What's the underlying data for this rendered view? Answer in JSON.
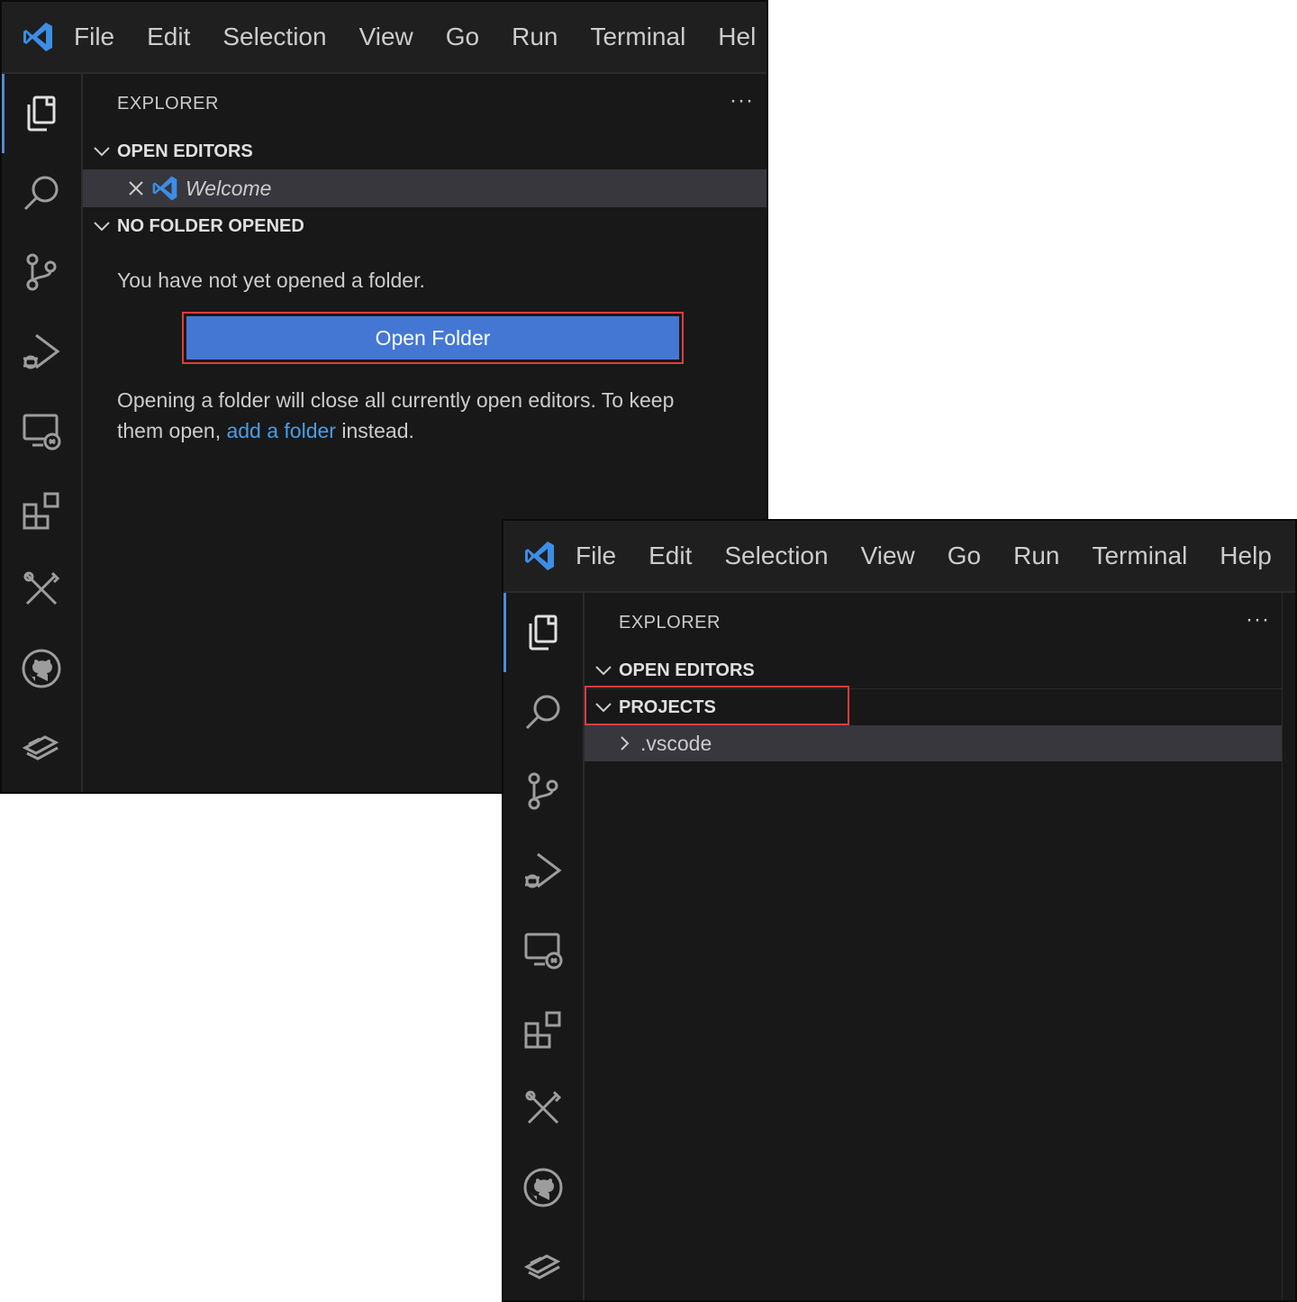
{
  "menu": [
    "File",
    "Edit",
    "Selection",
    "View",
    "Go",
    "Run",
    "Terminal",
    "Help"
  ],
  "activity_icons": [
    "explorer-icon",
    "search-icon",
    "source-control-icon",
    "run-debug-icon",
    "remote-explorer-icon",
    "extensions-icon",
    "tools-icon",
    "github-icon",
    "layers-icon"
  ],
  "window1": {
    "menu_last_truncated": "Hel",
    "explorer_title": "EXPLORER",
    "more": "···",
    "open_editors": "OPEN EDITORS",
    "welcome_tab": "Welcome",
    "no_folder": "NO FOLDER OPENED",
    "no_folder_msg": "You have not yet opened a folder.",
    "open_folder_button": "Open Folder",
    "note_part1": "Opening a folder will close all currently open editors. To keep them open, ",
    "note_link": "add a folder",
    "note_part2": " instead."
  },
  "window2": {
    "explorer_title": "EXPLORER",
    "more": "···",
    "open_editors": "OPEN EDITORS",
    "projects": "PROJECTS",
    "vscode_folder": ".vscode"
  },
  "colors": {
    "accent": "#4477d4",
    "highlight": "#e03c3c",
    "link": "#4a9de6"
  }
}
